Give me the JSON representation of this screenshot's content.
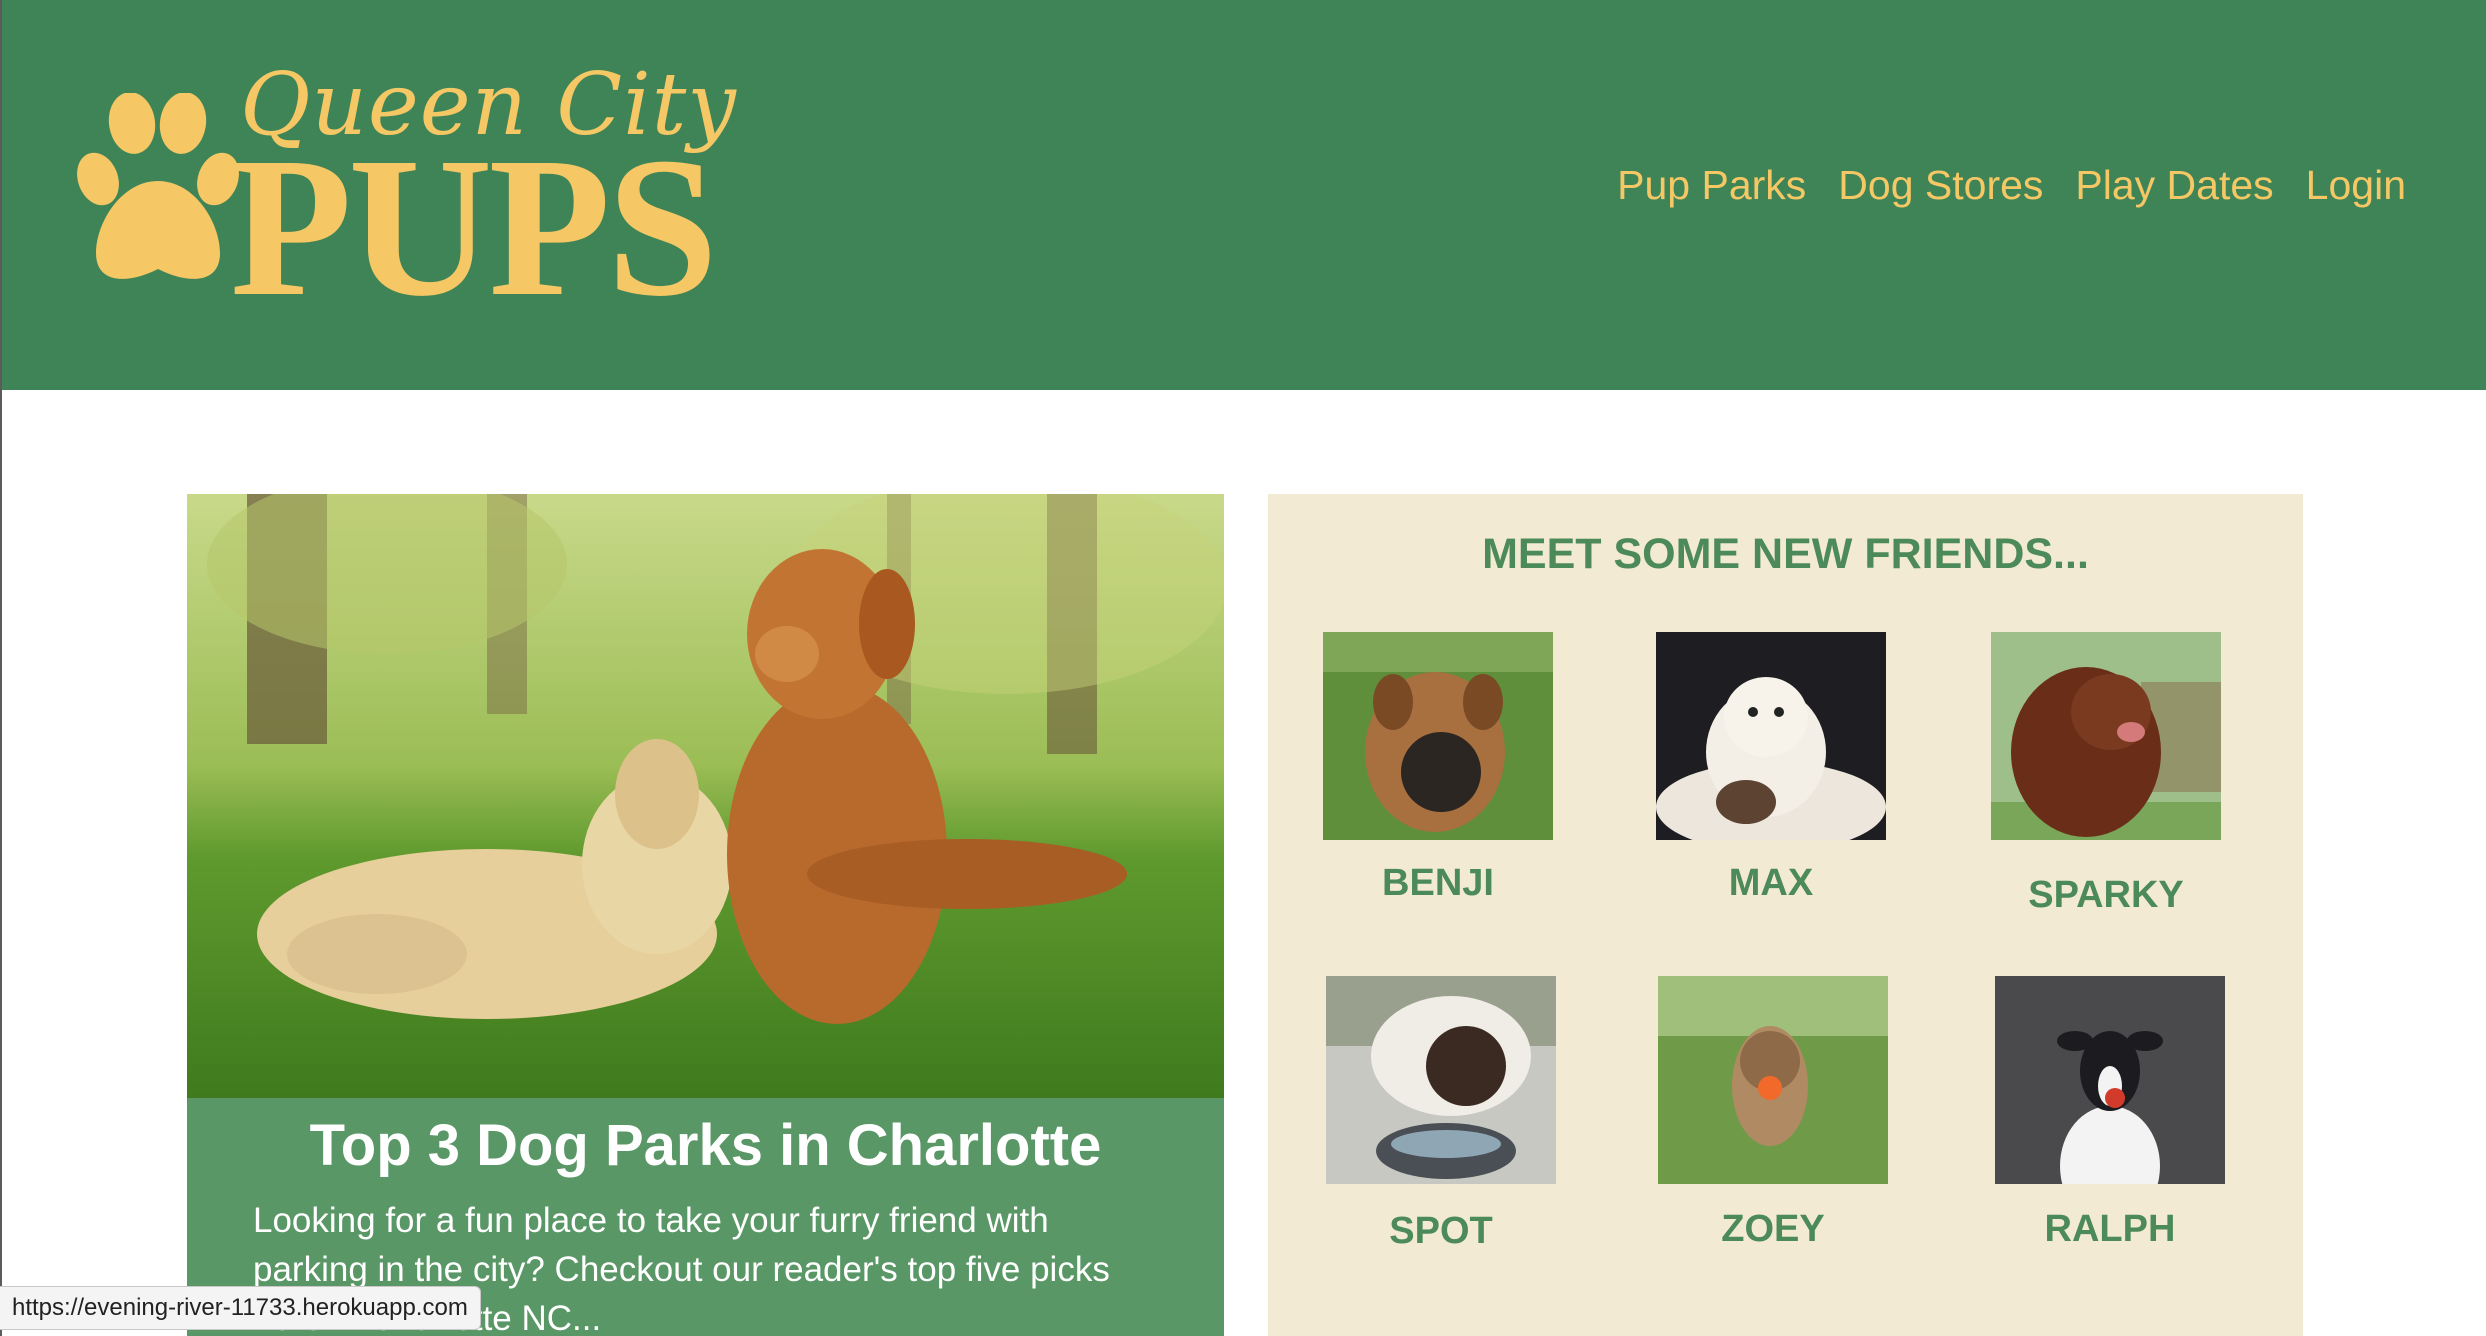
{
  "brand": {
    "tagline": "Queen City",
    "name": "PUPS",
    "color": "#f5c765",
    "header_bg": "#3f8457"
  },
  "nav": {
    "items": [
      {
        "label": "Pup Parks"
      },
      {
        "label": "Dog Stores"
      },
      {
        "label": "Play Dates"
      },
      {
        "label": "Login"
      }
    ]
  },
  "feature": {
    "title": "Top  3 Dog Parks in Charlotte",
    "text": "Looking for a fun place to take your furry friend with parking in the city?  Checkout our reader's top five picks here in Charlotte NC...",
    "image_icon": "dogs-in-park-photo"
  },
  "friends": {
    "title": "MEET SOME NEW FRIENDS...",
    "dogs": [
      {
        "name": "BENJI"
      },
      {
        "name": "MAX"
      },
      {
        "name": "SPARKY"
      },
      {
        "name": "SPOT"
      },
      {
        "name": "ZOEY"
      },
      {
        "name": "RALPH"
      }
    ]
  },
  "status_bar": {
    "url": "https://evening-river-11733.herokuapp.com"
  }
}
